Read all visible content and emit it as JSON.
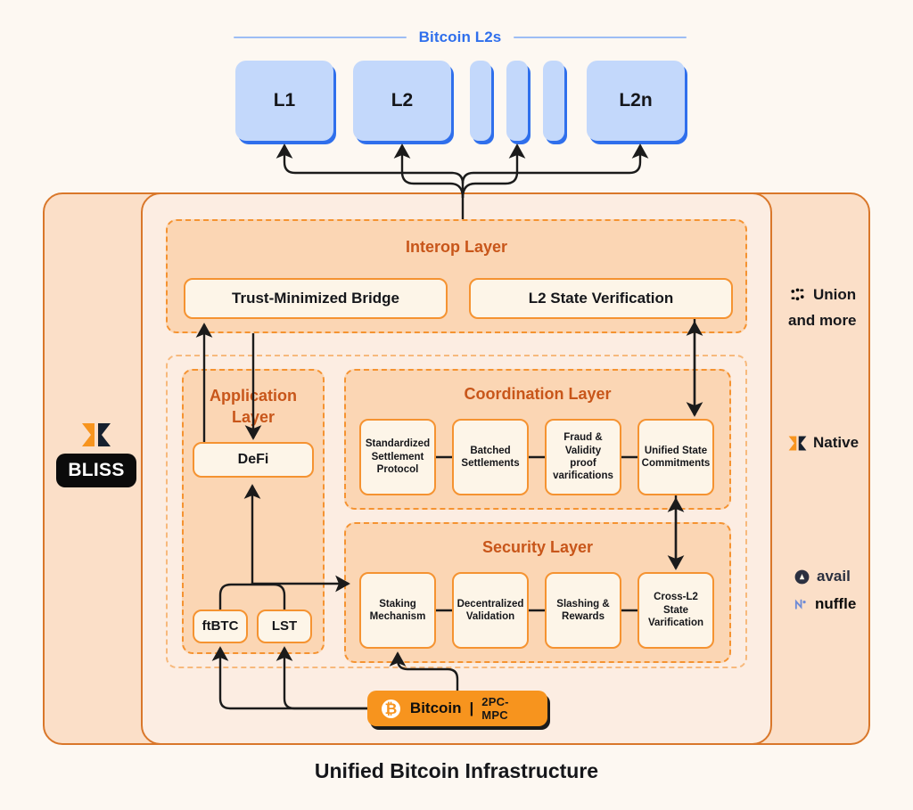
{
  "header": {
    "title": "Bitcoin L2s"
  },
  "l2_boxes": [
    {
      "label": "L1",
      "type": "wide"
    },
    {
      "label": "L2",
      "type": "wide"
    },
    {
      "label": "",
      "type": "slim"
    },
    {
      "label": "",
      "type": "slim"
    },
    {
      "label": "",
      "type": "slim"
    },
    {
      "label": "L2n",
      "type": "wide"
    }
  ],
  "interop_layer": {
    "title": "Interop Layer",
    "nodes": [
      {
        "label": "Trust-Minimized Bridge"
      },
      {
        "label": "L2 State Verification"
      }
    ]
  },
  "application_layer": {
    "title_line1": "Application",
    "title_line2": "Layer",
    "nodes": [
      {
        "label": "DeFi"
      },
      {
        "label": "ftBTC"
      },
      {
        "label": "LST"
      }
    ]
  },
  "coordination_layer": {
    "title": "Coordination Layer",
    "nodes": [
      {
        "label": "Standardized Settlement Protocol"
      },
      {
        "label": "Batched Settlements"
      },
      {
        "label": "Fraud & Validity proof varifications"
      },
      {
        "label": "Unified State Commitments"
      }
    ]
  },
  "security_layer": {
    "title": "Security Layer",
    "nodes": [
      {
        "label": "Staking Mechanism"
      },
      {
        "label": "Decentralized Validation"
      },
      {
        "label": "Slashing & Rewards"
      },
      {
        "label": "Cross-L2 State Varification"
      }
    ]
  },
  "bitcoin_badge": {
    "symbol": "₿",
    "name": "Bitcoin",
    "separator": "|",
    "protocol": "2PC-MPC"
  },
  "bliss": {
    "label": "BLISS"
  },
  "partners": [
    {
      "label": "Union",
      "icon": "union-icon"
    },
    {
      "label": "and more",
      "icon": ""
    },
    {
      "label": "Native",
      "icon": "native-icon"
    },
    {
      "label": "avail",
      "icon": "avail-icon"
    },
    {
      "label": "nuffle",
      "icon": "nuffle-icon"
    }
  ],
  "footer": {
    "title": "Unified Bitcoin Infrastructure"
  },
  "colors": {
    "page_bg": "#FDF8F2",
    "l2_fill": "#C3D8FB",
    "l2_shadow": "#2F6FEC",
    "accent_blue": "#2F6FEC",
    "outer_fill": "#FBDFC8",
    "inner_fill": "#FCEDE2",
    "layer_fill": "#FBD6B4",
    "layer_border": "#F59331",
    "layer_title": "#C8561A",
    "node_fill": "#FDF5E8",
    "bitcoin_orange": "#F7941E",
    "arrow": "#1B1B1B"
  }
}
